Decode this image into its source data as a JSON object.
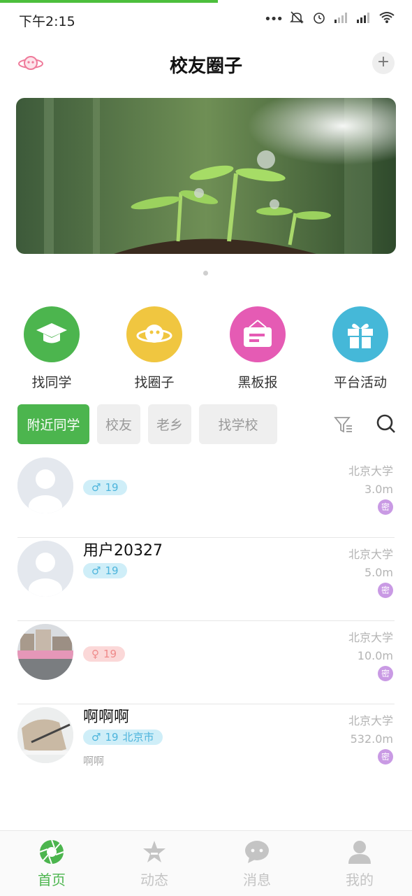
{
  "status_bar": {
    "time": "下午2:15"
  },
  "header": {
    "title": "校友圈子",
    "add_label": "+"
  },
  "quick_entries": [
    {
      "label": "找同学",
      "icon": "graduation-cap-icon",
      "color": "#4cb54e"
    },
    {
      "label": "找圈子",
      "icon": "planet-icon",
      "color": "#f0c640"
    },
    {
      "label": "黑板报",
      "icon": "board-icon",
      "color": "#e55bb4"
    },
    {
      "label": "平台活动",
      "icon": "gift-icon",
      "color": "#45b8d8"
    }
  ],
  "filters": [
    {
      "label": "附近同学",
      "active": true
    },
    {
      "label": "校友",
      "active": false
    },
    {
      "label": "老乡",
      "active": false
    },
    {
      "label": "找学校",
      "active": false
    }
  ],
  "users": [
    {
      "name": "",
      "gender": "♂",
      "age": "19",
      "location": "",
      "sub": "",
      "school": "北京大学",
      "distance": "3.0m",
      "badge": "密"
    },
    {
      "name": "用户20327",
      "gender": "♂",
      "age": "19",
      "location": "",
      "sub": "",
      "school": "北京大学",
      "distance": "5.0m",
      "badge": "密"
    },
    {
      "name": "",
      "gender": "♀",
      "age": "19",
      "location": "",
      "sub": "",
      "school": "北京大学",
      "distance": "10.0m",
      "badge": "密"
    },
    {
      "name": "啊啊啊",
      "gender": "♂",
      "age": "19",
      "location": "北京市",
      "sub": "啊啊",
      "school": "北京大学",
      "distance": "532.0m",
      "badge": "密"
    }
  ],
  "tabs": [
    {
      "label": "首页",
      "icon": "aperture-icon",
      "active": true
    },
    {
      "label": "动态",
      "icon": "star-icon",
      "active": false
    },
    {
      "label": "消息",
      "icon": "chat-icon",
      "active": false
    },
    {
      "label": "我的",
      "icon": "person-icon",
      "active": false
    }
  ],
  "colors": {
    "accent": "#4cb54e",
    "secret_badge": "#c99ae4",
    "male_tag": "#4db4dc",
    "female_tag": "#ef8a8a"
  }
}
